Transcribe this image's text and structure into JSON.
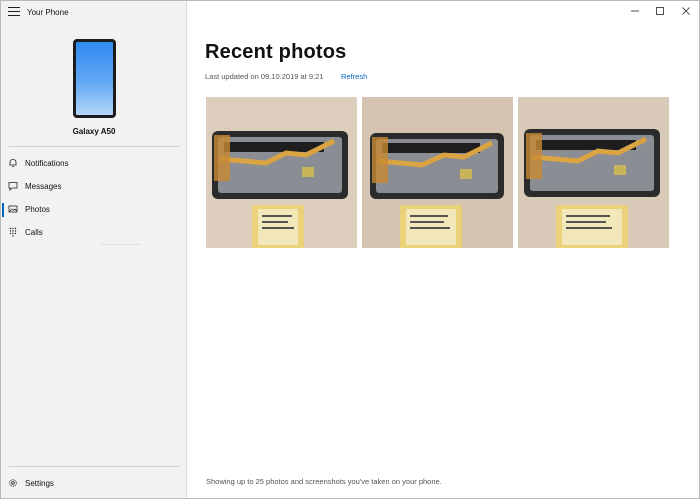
{
  "app": {
    "title": "Your Phone"
  },
  "device": {
    "name": "Galaxy A50"
  },
  "nav": {
    "items": [
      {
        "label": "Notifications",
        "icon": "bell-icon"
      },
      {
        "label": "Messages",
        "icon": "message-icon"
      },
      {
        "label": "Photos",
        "icon": "photos-icon",
        "active": true
      },
      {
        "label": "Calls",
        "icon": "dialpad-icon"
      }
    ],
    "settings_label": "Settings"
  },
  "main": {
    "title": "Recent photos",
    "last_updated": "Last updated on 09.10.2019 at 9:21",
    "refresh_label": "Refresh",
    "footer_note": "Showing up to 25 photos and screenshots you've taken on your phone."
  },
  "photos": [
    {
      "subject": "disassembled phone and battery"
    },
    {
      "subject": "disassembled phone and battery"
    },
    {
      "subject": "disassembled phone and battery"
    }
  ],
  "colors": {
    "accent": "#0067c0",
    "sidebar_bg": "#f2f2f2"
  }
}
